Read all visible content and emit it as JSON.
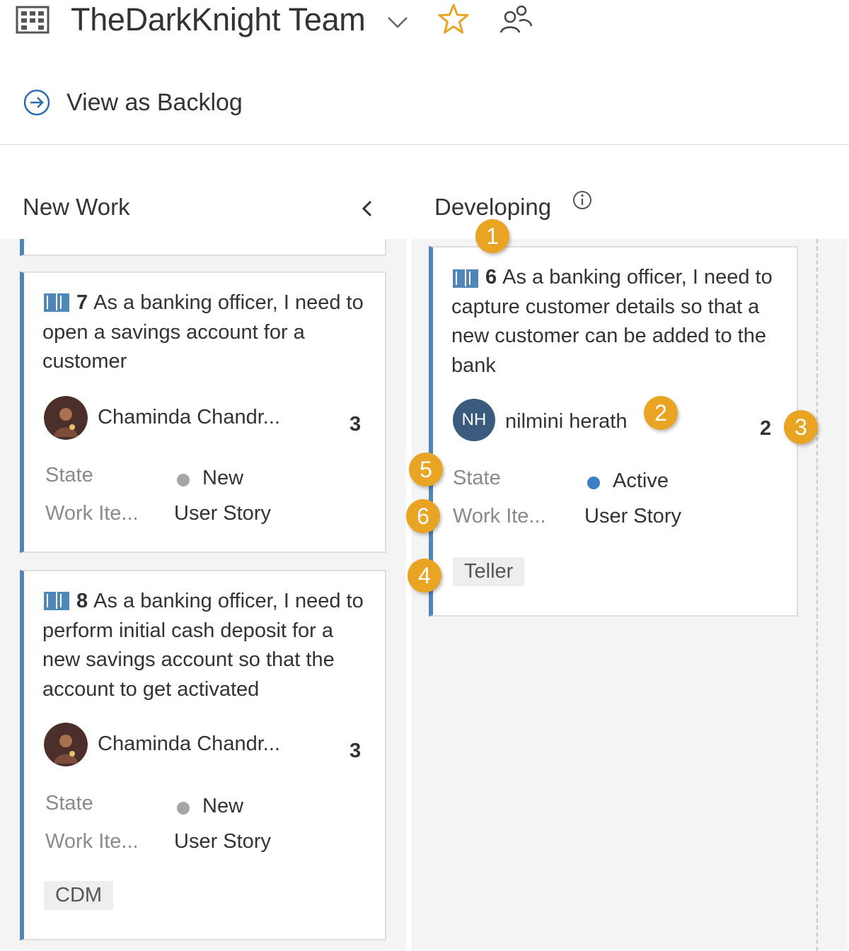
{
  "header": {
    "team_name": "TheDarkKnight Team",
    "team_icon": "board-grid-icon",
    "chevron_icon": "chevron-down-icon",
    "favorite_icon": "star-icon",
    "members_icon": "people-icon",
    "view_as_backlog": "View as Backlog"
  },
  "columns": [
    {
      "title": "New Work",
      "cards": [
        {
          "id": "7",
          "title": "As a banking officer, I need to open a savings account for a customer",
          "assignee": "Chaminda Chandr...",
          "points": "3",
          "state_label": "State",
          "state": "New",
          "state_color": "#a6a6a6",
          "type_label": "Work Ite...",
          "type": "User Story"
        },
        {
          "id": "8",
          "title": "As a banking officer, I need to perform initial cash deposit for a new savings account so that the account to get activated",
          "assignee": "Chaminda Chandr...",
          "points": "3",
          "state_label": "State",
          "state": "New",
          "state_color": "#a6a6a6",
          "type_label": "Work Ite...",
          "type": "User Story",
          "tag": "CDM"
        }
      ]
    },
    {
      "title": "Developing",
      "cards": [
        {
          "id": "6",
          "title": "As a banking officer, I need to capture customer details so that a new customer can be added to the bank",
          "assignee_initials": "NH",
          "assignee": "nilmini herath",
          "points": "2",
          "state_label": "State",
          "state": "Active",
          "state_color": "#3b7fc4",
          "type_label": "Work Ite...",
          "type": "User Story",
          "tag": "Teller"
        }
      ]
    }
  ],
  "callouts": [
    "1",
    "2",
    "3",
    "4",
    "5",
    "6"
  ],
  "colors": {
    "card_accent": "#4f86b8",
    "callout": "#e8a422",
    "lane_background": "#f4f4f4"
  }
}
